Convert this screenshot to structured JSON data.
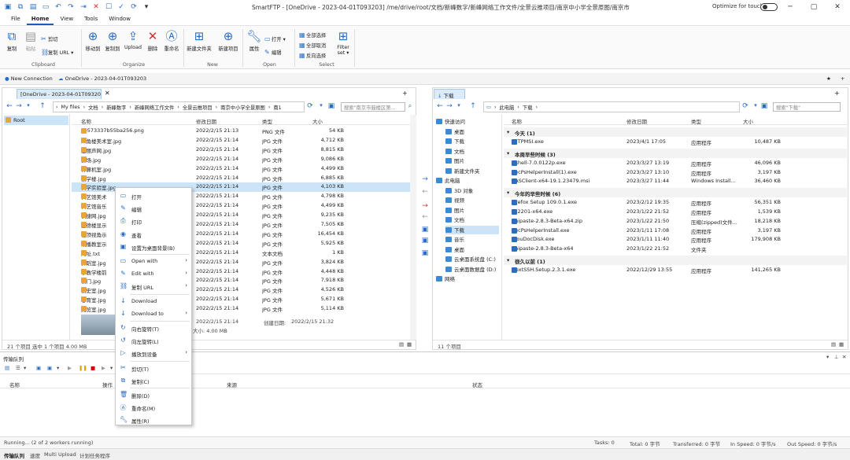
{
  "window": {
    "title": "SmartFTP - [OneDrive - 2023-04-01T093203] /me/drive/root/文档/新峰数字/新峰网络工作文件/全景云推项目/南京中小学全景原图/南京市鼓楼区第一中心小学/",
    "optimize_label": "Optimize for touch"
  },
  "menu": [
    "File",
    "Home",
    "View",
    "Tools",
    "Window"
  ],
  "ribbon": {
    "clipboard": {
      "copy": "复制",
      "paste": "粘贴",
      "cut": "剪切",
      "copy_url": "复制 URL",
      "group": "Clipboard"
    },
    "organize": {
      "move": "移动到",
      "copy_to": "复制到",
      "upload": "Upload",
      "delete": "删除",
      "rename": "重命名",
      "group": "Organize"
    },
    "new": {
      "new_folder": "新建文件夹",
      "new_item": "新建项目",
      "group": "New"
    },
    "open": {
      "properties": "属性",
      "open": "打开",
      "edit": "编辑",
      "group": "Open"
    },
    "select": {
      "select_all": "全部选择",
      "select_none": "全部取消",
      "invert": "反向选择",
      "filter": "Filter",
      "filter2": "set",
      "group": "Select"
    }
  },
  "conn_tabs": {
    "new_connection": "New Connection",
    "onedrive": "OneDrive - 2023-04-01T093203"
  },
  "left": {
    "tab": "[OneDrive - 2023-04-01T09320...",
    "path": [
      "My files",
      "文档",
      "新峰数字",
      "新峰网络工作文件",
      "全景云推项目",
      "南京中小学全景原图",
      "南1"
    ],
    "search_placeholder": "搜索\"南京市鼓楼区第...",
    "tree_root": "Root",
    "cols": {
      "name": "名称",
      "modified": "修改日期",
      "type": "类型",
      "size": "大小"
    },
    "files": [
      {
        "name": "c0573337b55ba256.png",
        "date": "2022/2/15 21:13",
        "type": "PNG 文件",
        "size": "54 KB"
      },
      {
        "name": "八角楼美术室.jpg",
        "date": "2022/2/15 21:14",
        "type": "JPG 文件",
        "size": "4,712 KB"
      },
      {
        "name": "宝丽声网.jpg",
        "date": "2022/2/15 21:14",
        "type": "JPG 文件",
        "size": "8,815 KB"
      },
      {
        "name": "操场.jpg",
        "date": "2022/2/15 21:14",
        "type": "JPG 文件",
        "size": "9,086 KB"
      },
      {
        "name": "计算机室.jpg",
        "date": "2022/2/15 21:14",
        "type": "JPG 文件",
        "size": "4,499 KB"
      },
      {
        "name": "教学楼.jpg",
        "date": "2022/2/15 21:14",
        "type": "JPG 文件",
        "size": "6,885 KB"
      },
      {
        "name": "科学实验室.jpg",
        "date": "2022/2/15 21:14",
        "type": "JPG 文件",
        "size": "4,103 KB"
      },
      {
        "name": "科艺馆美术",
        "date": "2022/2/15 21:14",
        "type": "JPG 文件",
        "size": "4,798 KB"
      },
      {
        "name": "科艺馆音乐",
        "date": "2022/2/15 21:14",
        "type": "JPG 文件",
        "size": "4,499 KB"
      },
      {
        "name": "快捷网.jpg",
        "date": "2022/2/15 21:14",
        "type": "JPG 文件",
        "size": "9,235 KB"
      },
      {
        "name": "立德楼显示",
        "date": "2022/2/15 21:14",
        "type": "JPG 文件",
        "size": "7,505 KB"
      },
      {
        "name": "楼顶视角示",
        "date": "2022/2/15 21:14",
        "type": "JPG 文件",
        "size": "16,454 KB"
      },
      {
        "name": "录播教室示",
        "date": "2022/2/15 21:14",
        "type": "JPG 文件",
        "size": "5,925 KB"
      },
      {
        "name": "网址.txt",
        "date": "2022/2/15 21:14",
        "type": "文本文档",
        "size": "1 KB"
      },
      {
        "name": "舞蹈室.jpg",
        "date": "2022/2/15 21:14",
        "type": "JPG 文件",
        "size": "3,824 KB"
      },
      {
        "name": "小教学楼前",
        "date": "2022/2/15 21:14",
        "type": "JPG 文件",
        "size": "4,448 KB"
      },
      {
        "name": "校门.jpg",
        "date": "2022/2/15 21:14",
        "type": "JPG 文件",
        "size": "7,918 KB"
      },
      {
        "name": "校史室.jpg",
        "date": "2022/2/15 21:14",
        "type": "JPG 文件",
        "size": "4,526 KB"
      },
      {
        "name": "心育室.jpg",
        "date": "2022/2/15 21:14",
        "type": "JPG 文件",
        "size": "5,671 KB"
      },
      {
        "name": "阅览室.jpg",
        "date": "2022/2/15 21:14",
        "type": "JPG 文件",
        "size": "5,114 KB"
      }
    ],
    "preview": {
      "modified": "2022/2/15 21:14",
      "created_label": "创建日期:",
      "created": "2022/2/15 21:32",
      "size": "大小: 4.00 MB"
    },
    "status": "21 个项目    选中 1 个项目  4.00 MB"
  },
  "context_menu": [
    {
      "label": "打开",
      "icon": "open-icon",
      "arrow": ""
    },
    {
      "label": "编辑",
      "icon": "edit-icon",
      "arrow": ""
    },
    {
      "label": "打印",
      "icon": "print-icon",
      "arrow": ""
    },
    {
      "label": "查看",
      "icon": "view-icon",
      "arrow": ""
    },
    {
      "label": "设置为桌面背景(B)",
      "icon": "wallpaper-icon",
      "arrow": ""
    },
    {
      "label": "Open with",
      "icon": "open-with-icon",
      "arrow": "›"
    },
    {
      "label": "Edit with",
      "icon": "edit-with-icon",
      "arrow": "›"
    },
    {
      "label": "复制 URL",
      "icon": "url-icon",
      "arrow": "›"
    },
    {
      "label": "Download",
      "icon": "download-icon",
      "arrow": ""
    },
    {
      "label": "Download to",
      "icon": "download-to-icon",
      "arrow": "›"
    },
    {
      "label": "向右旋转(T)",
      "icon": "rotate-right-icon",
      "arrow": ""
    },
    {
      "label": "向左旋转(L)",
      "icon": "rotate-left-icon",
      "arrow": ""
    },
    {
      "label": "播放到设备",
      "icon": "cast-icon",
      "arrow": "›"
    },
    {
      "label": "剪切(T)",
      "icon": "cut-icon",
      "arrow": ""
    },
    {
      "label": "复制(C)",
      "icon": "copy-icon",
      "arrow": ""
    },
    {
      "label": "删除(D)",
      "icon": "delete-icon",
      "arrow": ""
    },
    {
      "label": "重命名(M)",
      "icon": "rename-icon",
      "arrow": ""
    },
    {
      "label": "属性(R)",
      "icon": "properties-icon",
      "arrow": ""
    }
  ],
  "right": {
    "tab": "下载",
    "path": [
      "此电脑",
      "下载"
    ],
    "search_placeholder": "搜索\"下载\"",
    "cols": {
      "name": "名称",
      "modified": "修改日期",
      "type": "类型",
      "size": "大小"
    },
    "tree": [
      {
        "label": "快速访问",
        "indent": 0
      },
      {
        "label": "桌面",
        "indent": 1
      },
      {
        "label": "下载",
        "indent": 1
      },
      {
        "label": "文档",
        "indent": 1
      },
      {
        "label": "图片",
        "indent": 1
      },
      {
        "label": "新建文件夹",
        "indent": 1
      },
      {
        "label": "此电脑",
        "indent": 0
      },
      {
        "label": "3D 对象",
        "indent": 1
      },
      {
        "label": "视频",
        "indent": 1
      },
      {
        "label": "图片",
        "indent": 1
      },
      {
        "label": "文档",
        "indent": 1
      },
      {
        "label": "下载",
        "indent": 1
      },
      {
        "label": "音乐",
        "indent": 1
      },
      {
        "label": "桌面",
        "indent": 1
      },
      {
        "label": "云桌面系统盘 (C:)",
        "indent": 1
      },
      {
        "label": "云桌面数据盘 (D:)",
        "indent": 1
      },
      {
        "label": "网络",
        "indent": 0
      }
    ],
    "groups": [
      {
        "title": "今天 (1)",
        "files": [
          {
            "name": "SFTPMSI.exe",
            "date": "2023/4/1 17:05",
            "type": "应用程序",
            "size": "10,487 KB"
          }
        ]
      },
      {
        "title": "本周早些时候 (3)",
        "files": [
          {
            "name": "Xshell-7.0.0122p.exe",
            "date": "2023/3/27 13:19",
            "type": "应用程序",
            "size": "46,096 KB"
          },
          {
            "name": "SecPsHelperInstall(1).exe",
            "date": "2023/3/27 13:10",
            "type": "应用程序",
            "size": "3,197 KB"
          },
          {
            "name": "RASClient-x64-19.1.23479.msi",
            "date": "2023/3/27 11:44",
            "type": "Windows Install...",
            "size": "36,460 KB"
          }
        ]
      },
      {
        "title": "今年的早些时候 (6)",
        "files": [
          {
            "name": "Firefox Setup 109.0.1.exe",
            "date": "2023/2/12 19:35",
            "type": "应用程序",
            "size": "56,351 KB"
          },
          {
            "name": "7z2201-x64.exe",
            "date": "2023/1/22 21:52",
            "type": "应用程序",
            "size": "1,539 KB"
          },
          {
            "name": "Snipaste-2.8.3-Beta-x64.zip",
            "date": "2023/1/22 21:50",
            "type": "压缩(zipped)文件...",
            "size": "18,218 KB"
          },
          {
            "name": "SecPsHelperInstall.exe",
            "date": "2023/1/11 17:08",
            "type": "应用程序",
            "size": "3,197 KB"
          },
          {
            "name": "ClouDocDisk.exe",
            "date": "2023/1/11 11:40",
            "type": "应用程序",
            "size": "179,908 KB"
          },
          {
            "name": "Snipaste-2.8.3-Beta-x64",
            "date": "2023/1/22 21:52",
            "type": "文件夹",
            "size": ""
          }
        ]
      },
      {
        "title": "很久以前 (1)",
        "files": [
          {
            "name": "NextSSH.Setup.2.3.1.exe",
            "date": "2022/12/29 13:55",
            "type": "应用程序",
            "size": "141,265 KB"
          }
        ]
      }
    ],
    "status": "11 个项目"
  },
  "queue": {
    "title": "传输队列",
    "cols": [
      "名称",
      "操作",
      "来源",
      "状态"
    ]
  },
  "statusbar": {
    "running": "Running... (2 of 2 workers running)",
    "tasks": "Tasks: 0",
    "total": "Total: 0 字节",
    "transferred": "Transferred: 0 字节",
    "in_speed": "In Speed: 0 字节/s",
    "out_speed": "Out Speed: 0 字节/s"
  },
  "bottom_tabs": [
    "传输队列",
    "速度",
    "Multi Upload",
    "计划任务程序"
  ]
}
